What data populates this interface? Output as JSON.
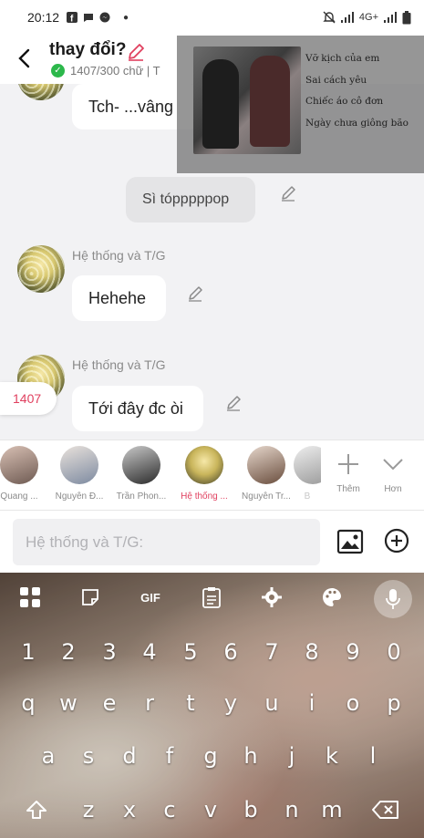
{
  "status_bar": {
    "time": "20:12",
    "network": "4G+"
  },
  "header": {
    "title": "thay đổi?",
    "subtitle": "1407/300 chữ | T"
  },
  "overlay": {
    "lines": [
      "Vỡ kịch của em",
      "Sai cách yêu",
      "Chiếc áo cô đơn",
      "Ngày chưa giông bão"
    ]
  },
  "messages": [
    {
      "text": "Tch- ...vâng"
    },
    {
      "text": "Sì tópppppop"
    },
    {
      "sender": "Hệ thống và T/G",
      "text": "Hehehe"
    },
    {
      "sender": "Hệ thống và T/G",
      "text": "Tới đây đc òi"
    }
  ],
  "side_counter": "1407",
  "characters": [
    {
      "name": "Quang ..."
    },
    {
      "name": "Nguyễn Đ..."
    },
    {
      "name": "Trần Phon..."
    },
    {
      "name": "Hệ thống ..."
    },
    {
      "name": "Nguyễn Tr..."
    },
    {
      "name": "B"
    }
  ],
  "strip_actions": {
    "add_label": "Thêm",
    "more_label": "Hơn"
  },
  "composer": {
    "placeholder": "Hệ thống và T/G:"
  },
  "keyboard": {
    "gif_label": "GIF",
    "row_numbers": [
      "1",
      "2",
      "3",
      "4",
      "5",
      "6",
      "7",
      "8",
      "9",
      "0"
    ],
    "row_1": [
      "q",
      "w",
      "e",
      "r",
      "t",
      "y",
      "u",
      "i",
      "o",
      "p"
    ],
    "row_2": [
      "a",
      "s",
      "d",
      "f",
      "g",
      "h",
      "j",
      "k",
      "l"
    ],
    "row_3": [
      "z",
      "x",
      "c",
      "v",
      "b",
      "n",
      "m"
    ]
  },
  "colors": {
    "accent": "#e0405f",
    "verified": "#2cb84b"
  }
}
